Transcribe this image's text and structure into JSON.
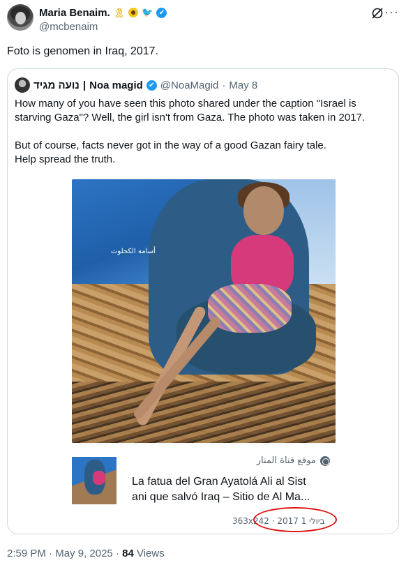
{
  "author": {
    "display_name": "Maria Benaim.",
    "handle": "@mcbenaim"
  },
  "tweet": {
    "text": "Foto is genomen in Iraq, 2017."
  },
  "quote": {
    "name_hebrew": "נועה מגיד",
    "name_sep": "|",
    "name_latin": "Noa magid",
    "handle": "@NoaMagid",
    "dot": "·",
    "date": "May 8",
    "para1": "How many of you have seen this photo shared under the caption \"Israel is starving Gaza\"? Well, the girl isn't from Gaza. The photo was taken in 2017.",
    "para2_line1": "But of course, facts never got in the way of a good Gazan fairy tale.",
    "para2_line2": "Help spread the truth.",
    "photo_watermark": "أسامة الكحلوت"
  },
  "link_card": {
    "source": "موقع قناة المنار",
    "title_line1": "La fatua del Gran Ayatolá Ali al Sist",
    "title_line2": "ani que salvó Iraq – Sitio de Al Ma...",
    "meta": "363x242 · 2017 1 ביולי"
  },
  "footer": {
    "time": "2:59 PM",
    "dot": "·",
    "date": "May 9, 2025",
    "views_count": "84",
    "views_label": "Views"
  },
  "icons": {
    "verified_color": "#1d9bf0",
    "annotation_color": "#dd1111"
  }
}
